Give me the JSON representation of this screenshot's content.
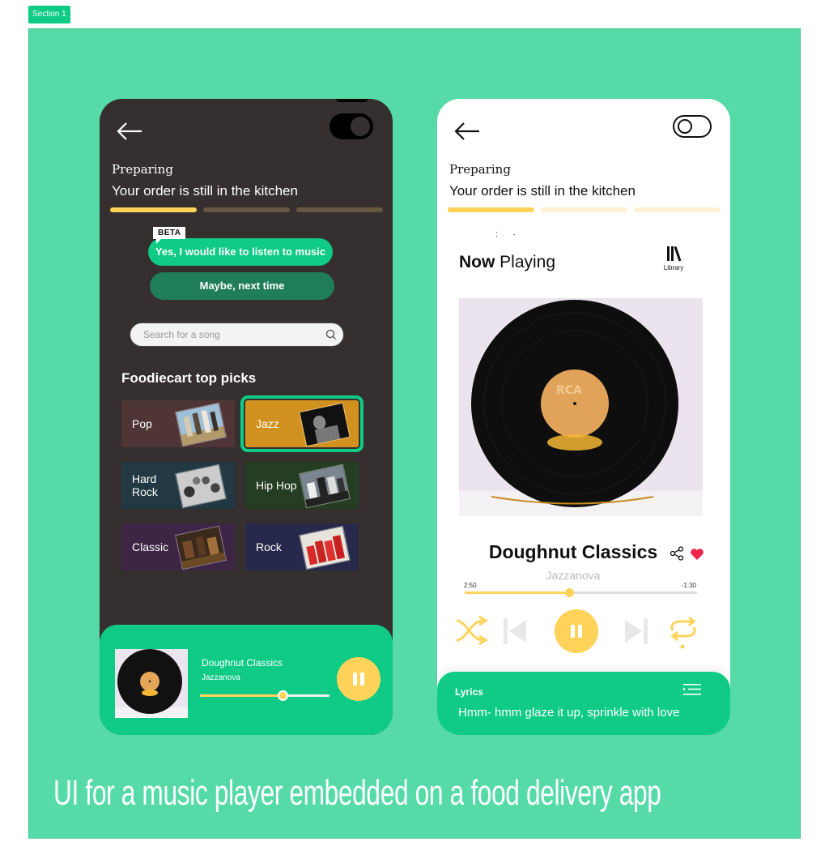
{
  "section_tag": "Section 1",
  "caption": "UI for a music player embedded on a food delivery app",
  "colors": {
    "accent_green": "#0fcb86",
    "section_bg": "#56dba8",
    "dark_bg": "#352f2f",
    "yellow": "#ffd35a",
    "heart_red": "#f0254e"
  },
  "dark_screen": {
    "back_icon": "arrow-left-icon",
    "toggle_state": "on",
    "order_status": {
      "label": "Preparing",
      "message": "Your order is still in the kitchen",
      "steps_completed": 1,
      "steps_total": 3
    },
    "beta_badge": "BETA",
    "yes_button": "Yes, I would like to listen to music",
    "maybe_button": "Maybe, next time",
    "search": {
      "placeholder": "Search for a song",
      "value": ""
    },
    "picks_title": "Foodiecart top picks",
    "genres": [
      {
        "label": "Pop",
        "color": "#4f3535",
        "selected": false
      },
      {
        "label": "Jazz",
        "color": "#d1911e",
        "selected": true
      },
      {
        "label": "Hard\nRock",
        "color": "#223842",
        "selected": false
      },
      {
        "label": "Hip Hop",
        "color": "#253d22",
        "selected": false
      },
      {
        "label": "Classic",
        "color": "#3f2545",
        "selected": false
      },
      {
        "label": "Rock",
        "color": "#26294b",
        "selected": false
      }
    ],
    "mini_player": {
      "title": "Doughnut Classics",
      "artist": "Jazzanova",
      "progress": 0.64,
      "play_state": "playing"
    }
  },
  "light_screen": {
    "back_icon": "arrow-left-icon",
    "toggle_state": "off",
    "order_status": {
      "label": "Preparing",
      "message": "Your order is still in the kitchen",
      "steps_completed": 1,
      "steps_total": 3
    },
    "now_playing": {
      "bold": "Now",
      "rest": " Playing"
    },
    "library_label": "Library",
    "track": {
      "title": "Doughnut Classics",
      "artist": "Jazzanova",
      "elapsed": "2:50",
      "remaining": "-1:30",
      "progress": 0.45,
      "liked": true,
      "play_state": "playing"
    },
    "lyrics": {
      "label": "Lyrics",
      "line": "Hmm- hmm glaze it up, sprinkle with love"
    }
  }
}
